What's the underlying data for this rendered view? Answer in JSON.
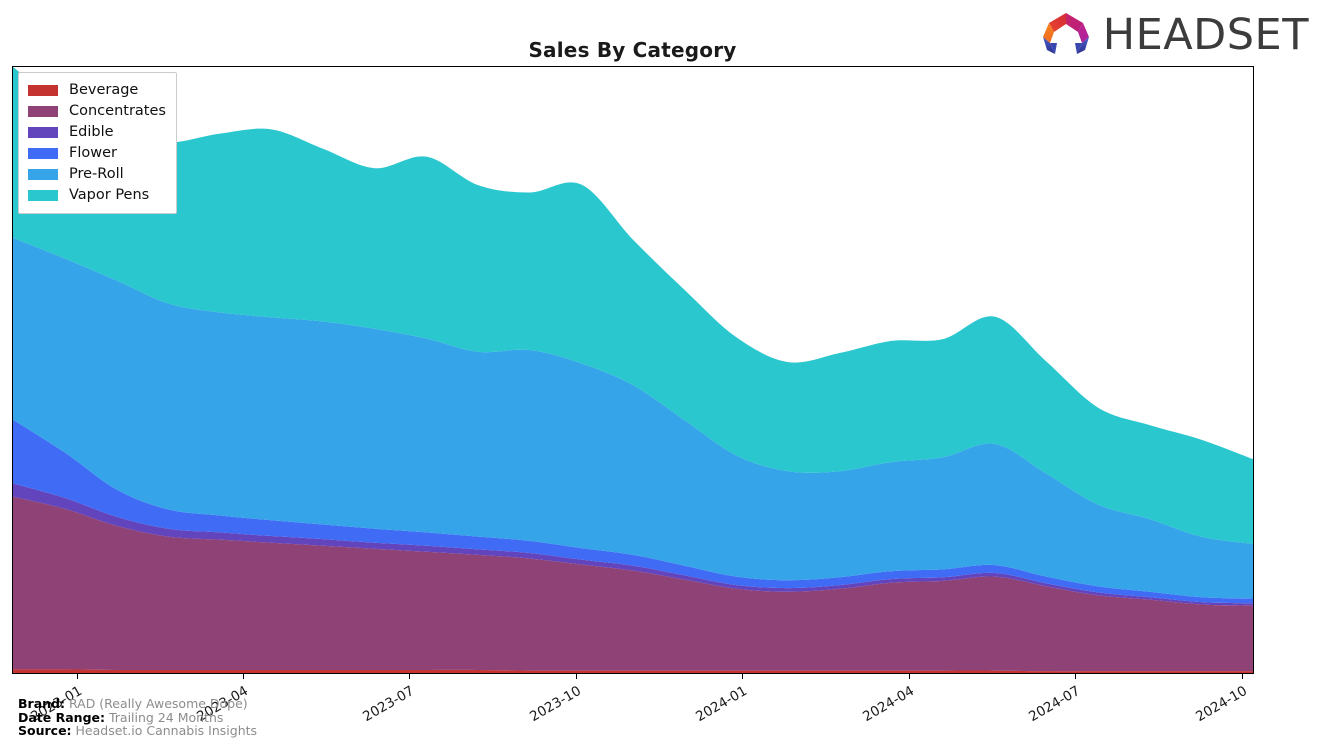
{
  "header": {
    "title": "Sales By Category",
    "logo_word": "HEADSET",
    "logo_mark_name": "headset-logo-mark"
  },
  "footnotes": [
    {
      "key": "Brand:",
      "value": "RAD (Really Awesome Dope)"
    },
    {
      "key": "Date Range:",
      "value": "Trailing 24 Months"
    },
    {
      "key": "Source:",
      "value": "Headset.io Cannabis Insights"
    }
  ],
  "legend": {
    "position": "upper-left",
    "items": [
      {
        "label": "Beverage",
        "color": "#c53331"
      },
      {
        "label": "Concentrates",
        "color": "#8f4276"
      },
      {
        "label": "Edible",
        "color": "#6244bc"
      },
      {
        "label": "Flower",
        "color": "#3f6bf5"
      },
      {
        "label": "Pre-Roll",
        "color": "#35a4e8"
      },
      {
        "label": "Vapor Pens",
        "color": "#2ac7cf"
      }
    ]
  },
  "chart_data": {
    "type": "area",
    "stacked": true,
    "interpolation": "smooth",
    "title": "Sales By Category",
    "xlabel": "",
    "ylabel": "",
    "grid": false,
    "legend_position": "upper-left",
    "axis_tick_rotation_deg": -30,
    "x_tick_labels": [
      "2023-01",
      "2023-04",
      "2023-07",
      "2023-10",
      "2024-01",
      "2024-04",
      "2024-07",
      "2024-10"
    ],
    "x_tick_positions_frac": [
      0.052,
      0.186,
      0.32,
      0.454,
      0.588,
      0.722,
      0.856,
      0.99
    ],
    "x": [
      "2022-11",
      "2022-12",
      "2023-01",
      "2023-02",
      "2023-03",
      "2023-04",
      "2023-05",
      "2023-06",
      "2023-07",
      "2023-08",
      "2023-09",
      "2023-10",
      "2023-11",
      "2023-12",
      "2024-01",
      "2024-02",
      "2024-03",
      "2024-04",
      "2024-05",
      "2024-06",
      "2024-07",
      "2024-08",
      "2024-09",
      "2024-10",
      "2024-11"
    ],
    "ylim": [
      0,
      100
    ],
    "y_axis_visible": false,
    "series": [
      {
        "name": "Beverage",
        "color": "#c53331",
        "values": [
          0.6,
          0.6,
          0.5,
          0.5,
          0.5,
          0.5,
          0.5,
          0.5,
          0.5,
          0.5,
          0.4,
          0.4,
          0.4,
          0.4,
          0.4,
          0.4,
          0.4,
          0.4,
          0.4,
          0.4,
          0.3,
          0.3,
          0.3,
          0.3,
          0.3
        ]
      },
      {
        "name": "Concentrates",
        "color": "#8f4276",
        "values": [
          28.5,
          26.5,
          23.8,
          22.0,
          21.5,
          21.0,
          20.5,
          20.0,
          19.5,
          19.0,
          18.5,
          17.5,
          16.5,
          15.0,
          13.5,
          13.0,
          13.5,
          14.5,
          14.8,
          15.5,
          14.0,
          12.5,
          11.8,
          11.0,
          10.8
        ]
      },
      {
        "name": "Edible",
        "color": "#6244bc",
        "values": [
          2.2,
          1.8,
          1.5,
          1.3,
          1.2,
          1.1,
          1.1,
          1.0,
          1.0,
          0.9,
          0.9,
          0.8,
          0.8,
          0.7,
          0.6,
          0.6,
          0.6,
          0.6,
          0.6,
          0.6,
          0.5,
          0.5,
          0.4,
          0.4,
          0.4
        ]
      },
      {
        "name": "Flower",
        "color": "#3f6bf5",
        "values": [
          10.5,
          7.5,
          4.5,
          3.2,
          2.8,
          2.6,
          2.4,
          2.3,
          2.2,
          2.1,
          2.0,
          1.9,
          1.8,
          1.6,
          1.4,
          1.3,
          1.3,
          1.3,
          1.3,
          1.3,
          1.1,
          1.0,
          0.9,
          0.8,
          0.8
        ]
      },
      {
        "name": "Pre-Roll",
        "color": "#35a4e8",
        "values": [
          30.0,
          32.0,
          34.5,
          34.0,
          33.5,
          33.5,
          33.5,
          33.0,
          32.0,
          30.5,
          31.5,
          30.5,
          28.0,
          24.0,
          20.0,
          18.0,
          17.5,
          18.0,
          18.5,
          20.0,
          17.0,
          13.5,
          12.0,
          10.0,
          9.0
        ]
      },
      {
        "name": "Vapor Pens",
        "color": "#2ac7cf",
        "values": [
          28.2,
          25.0,
          24.0,
          26.5,
          29.5,
          31.0,
          28.5,
          26.5,
          30.0,
          27.5,
          26.0,
          29.5,
          24.0,
          21.5,
          19.5,
          18.0,
          19.5,
          20.0,
          19.5,
          21.0,
          18.5,
          16.0,
          15.5,
          16.0,
          14.0
        ]
      }
    ]
  }
}
